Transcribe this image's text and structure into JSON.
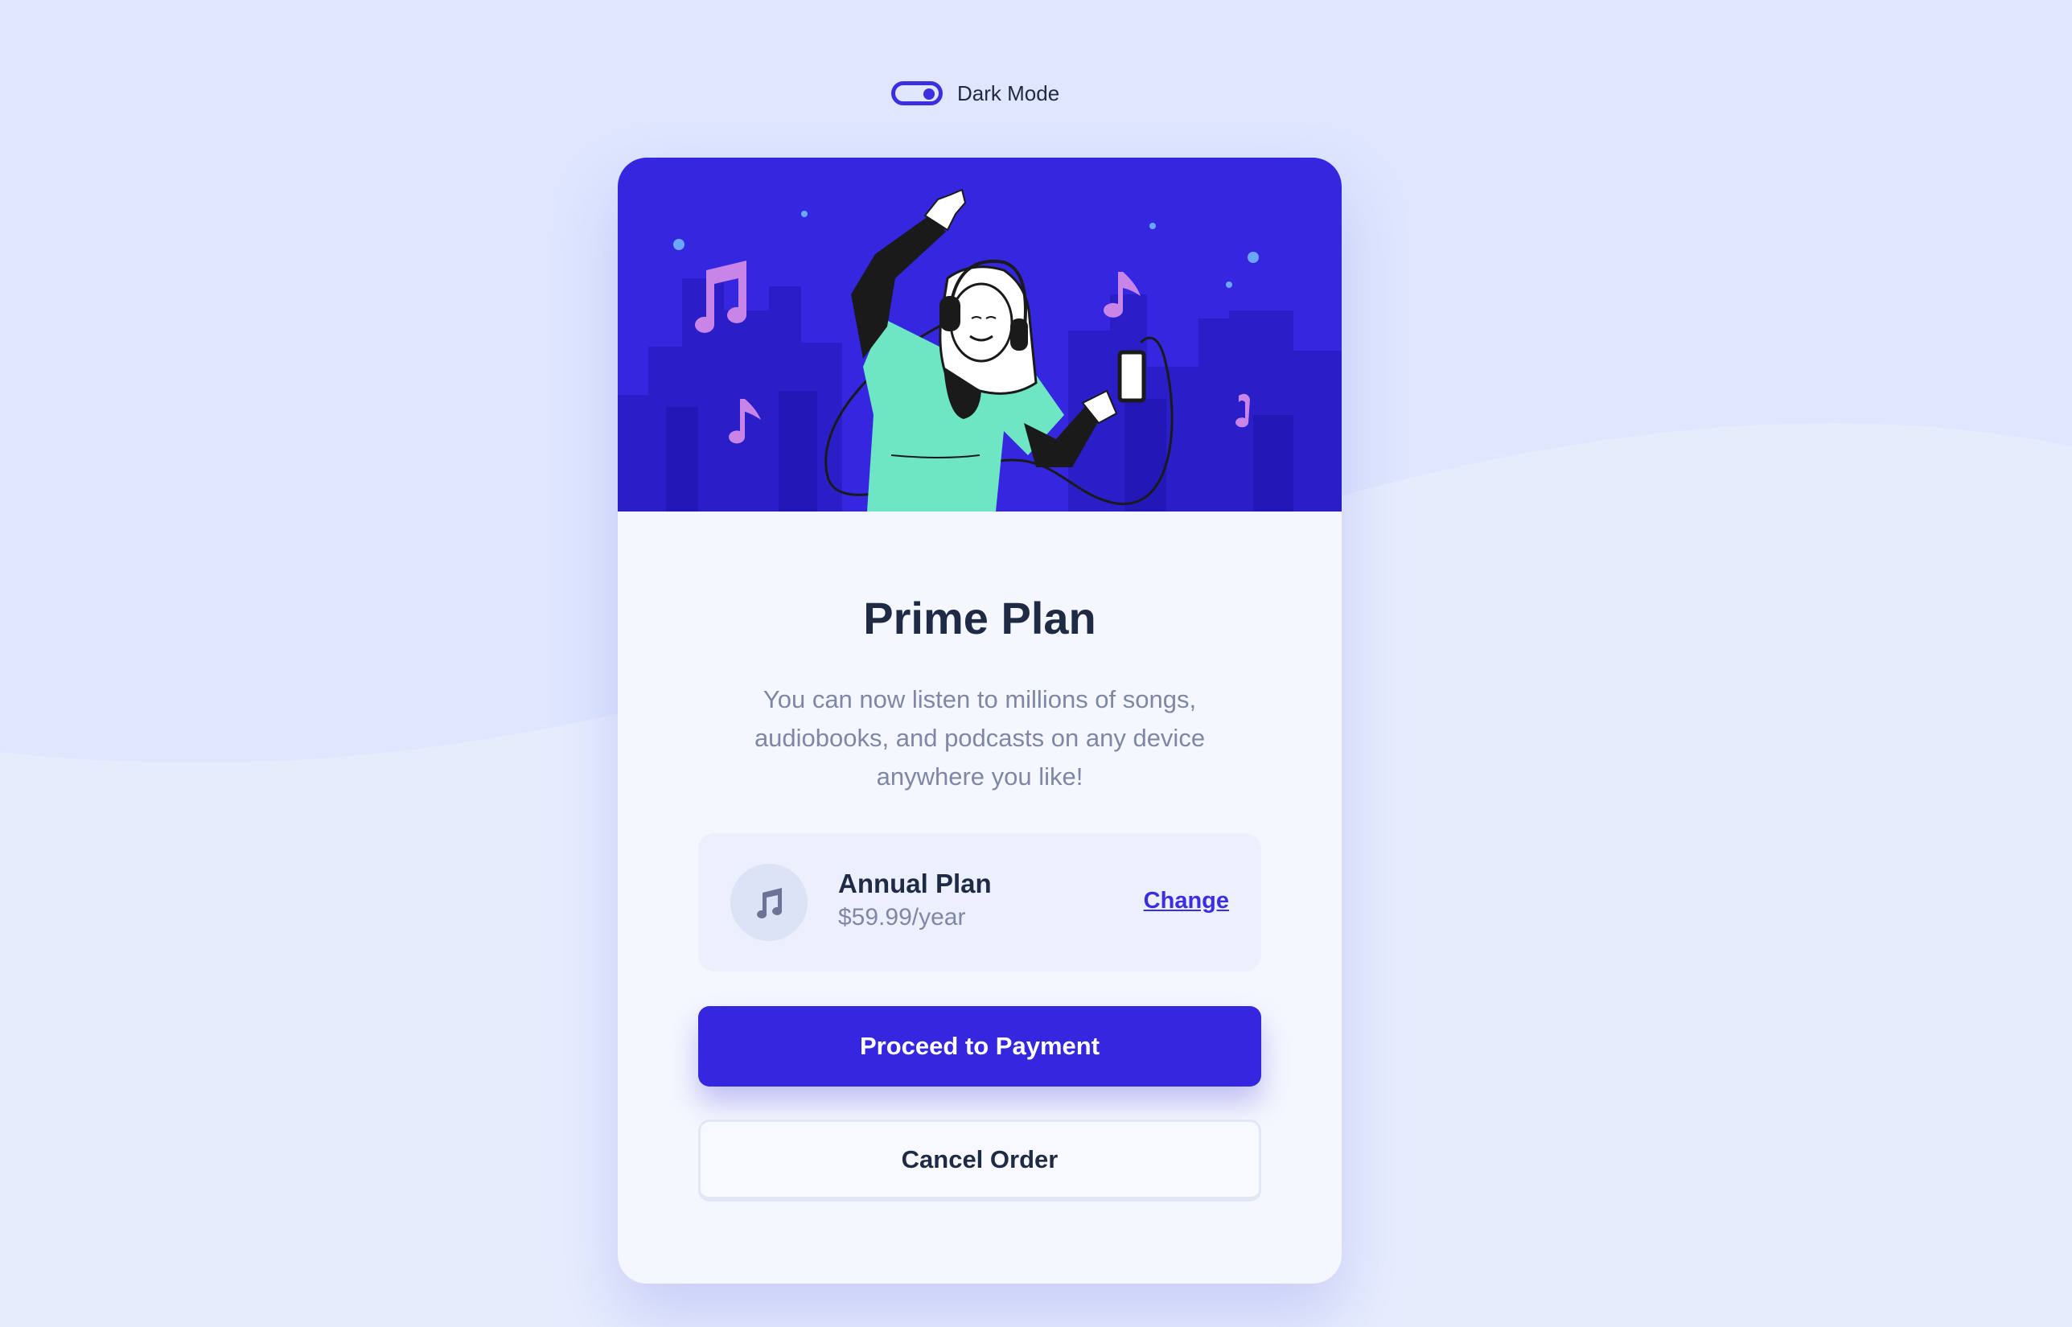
{
  "theme_toggle": {
    "label": "Dark Mode",
    "icon": "toggle-icon"
  },
  "card": {
    "hero_image": "woman-listening-music-illustration",
    "title": "Prime Plan",
    "description": "You can now listen to millions of songs, audiobooks, and podcasts on any device anywhere you like!",
    "plan": {
      "icon": "music-note-icon",
      "name": "Annual Plan",
      "price": "$59.99/year",
      "change_label": "Change"
    },
    "primary_button": "Proceed to Payment",
    "secondary_button": "Cancel Order"
  },
  "colors": {
    "background": "#dfe6fe",
    "accent": "#3427df",
    "card": "#f4f7fe",
    "heading": "#1f2a44",
    "body_text": "#7f87a5",
    "illustration_teal": "#6ee6c4",
    "illustration_pink": "#c884e6"
  }
}
